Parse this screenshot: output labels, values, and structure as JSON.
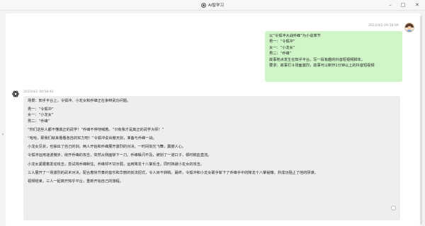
{
  "window": {
    "title": "AI智学习",
    "app_icon": "brain-icon",
    "controls": {
      "minimize": "–",
      "maximize": "□",
      "close": "✕"
    }
  },
  "user_message": {
    "timestamp": "2023/4/2 09:58:09",
    "lines": [
      "以“令狐冲大战乔峰”为小说章节",
      "男一：“令狐冲”",
      "女一：“小龙女”",
      "男二：“乔峰”",
      "故事地点发生在知乎平台。写一段有趣的抖音短视频脚本。",
      "要求：故事打斗场面激烈，故事可以制作1分钟以上的抖音短视频"
    ]
  },
  "ai_message": {
    "timestamp": "2023/4/2 09:58:40",
    "paragraphs": [
      [
        "场景：知乎平台上，令狐冲、小龙女和乔峰正在争辩武功问题。"
      ],
      [
        "男一：“令狐冲”",
        "女一：“小龙女”",
        "男二：“乔峰”"
      ],
      [
        "“你们这些人都不懂真正的武学！”乔峰不停地喊着。“只有我才是真正的武学大师！”"
      ],
      [
        "“哈哈，那我们就来看看各自的实力吧！”令狐冲说出傲天剑，准备与乔峰一战。"
      ],
      [
        "小龙女见状，也抽出了自己的剑，两人开始和乔峰展开激烈的对决。一时间剑光飞舞，震撼人心。"
      ],
      [
        "令狐冲运用凌波微步，绕开乔峰的攻击，突然从侧面斩下一刀。乔峰躲闪不及，被划了一道口子，顿时鲜血直流。"
      ],
      [
        "小龙女紧跟着发动攻击，尝试将乔峰制住。乔峰却不甘示弱，运用降龙十八掌反击，同时挡避小龙女的攻击。"
      ],
      [
        "三人展开了一场激烈的武术对决，配合着快节奏的音乐和华丽的剑法招式，令人目不转睛。最终，令狐冲和小龙女联手斩下了乔峰手中的降龙十八掌秘籍，并成功阻止了他的阴谋。"
      ],
      [
        "视频结束，三人一起离开知乎平台，重新开始自己的旅程。"
      ]
    ]
  }
}
